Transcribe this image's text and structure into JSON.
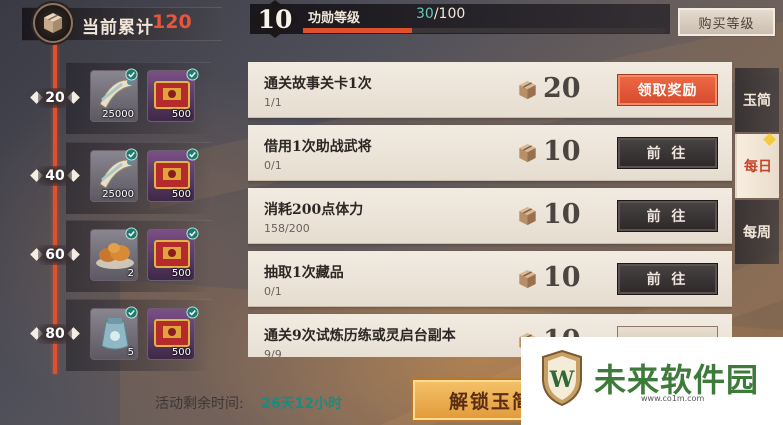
{
  "header": {
    "total_label": "当前累计",
    "total_value": "120"
  },
  "merit": {
    "level": "10",
    "label": "功勋等级",
    "progress_current": "30",
    "progress_total": "/100",
    "progress_fraction": 0.3,
    "buy_button": "购买等级"
  },
  "milestones": [
    {
      "level": "20",
      "rewards": [
        {
          "icon": "scroll-icon",
          "qty": "25000",
          "claimed": true
        },
        {
          "icon": "red-book-icon",
          "qty": "500",
          "claimed": true
        }
      ]
    },
    {
      "level": "40",
      "rewards": [
        {
          "icon": "scroll-icon",
          "qty": "25000",
          "claimed": true
        },
        {
          "icon": "red-book-icon",
          "qty": "500",
          "claimed": true
        }
      ]
    },
    {
      "level": "60",
      "rewards": [
        {
          "icon": "fried-food-icon",
          "qty": "2",
          "claimed": true
        },
        {
          "icon": "red-book-icon",
          "qty": "500",
          "claimed": true
        }
      ]
    },
    {
      "level": "80",
      "rewards": [
        {
          "icon": "blue-bag-icon",
          "qty": "5",
          "claimed": true
        },
        {
          "icon": "red-book-icon",
          "qty": "500",
          "claimed": true
        }
      ]
    }
  ],
  "tasks": [
    {
      "title": "通关故事关卡1次",
      "progress": "1/1",
      "reward_icon": "box-icon",
      "reward": "20",
      "button": "领取奖励",
      "button_type": "claim"
    },
    {
      "title": "借用1次助战武将",
      "progress": "0/1",
      "reward_icon": "box-icon",
      "reward": "10",
      "button": "前 往",
      "button_type": "go"
    },
    {
      "title": "消耗200点体力",
      "progress": "158/200",
      "reward_icon": "box-icon",
      "reward": "10",
      "button": "前 往",
      "button_type": "go"
    },
    {
      "title": "抽取1次藏品",
      "progress": "0/1",
      "reward_icon": "box-icon",
      "reward": "10",
      "button": "前 往",
      "button_type": "go"
    },
    {
      "title": "通关9次试炼历练或灵启台副本",
      "progress": "9/9",
      "reward_icon": "box-icon",
      "reward": "10",
      "button": "",
      "button_type": "partial"
    }
  ],
  "tabs": [
    {
      "label": "玉简",
      "active": false
    },
    {
      "label": "每日",
      "active": true,
      "badge": true
    },
    {
      "label": "每周",
      "active": false
    }
  ],
  "footer": {
    "remaining_label": "活动剩余时间:",
    "remaining_value": "26天12小时",
    "unlock_button": "解锁玉简"
  },
  "watermark": {
    "logo_letter": "W",
    "name": "未来软件园",
    "url": "www.co1m.com"
  },
  "colors": {
    "accent_red": "#e0502d",
    "claim_button": "#e45a38",
    "teal_text": "#1d8a82",
    "gold_button": "#eab04e"
  }
}
